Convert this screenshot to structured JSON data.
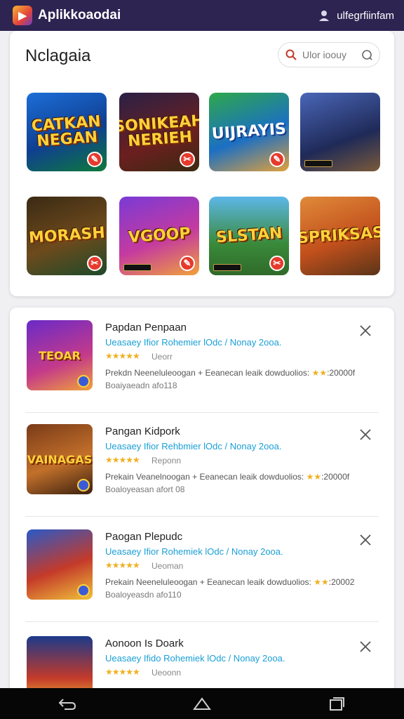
{
  "header": {
    "app_name": "Aplikkoaodai",
    "account_label": "ulfegrfiinfam"
  },
  "featured": {
    "title": "Nclagaia",
    "search_placeholder": "Ulor ioouy",
    "tiles": [
      {
        "title": "CATKAN NEGAN"
      },
      {
        "title": "SONIKEAH NERIEH"
      },
      {
        "title": "UIJRAYIS"
      },
      {
        "title": ""
      },
      {
        "title": "MORASH"
      },
      {
        "title": "VGOOP"
      },
      {
        "title": "SLSTAN"
      },
      {
        "title": "SPRIKSAS"
      }
    ]
  },
  "apps": [
    {
      "thumb_title": "TEOAR",
      "name": "Papdan Penpaan",
      "developer": "Ueasaey Ifior Rohemier lOdc / Nonay 2ooa.",
      "stars": "★★★★★",
      "rating_text": "Ueorr",
      "desc_text": "Prekdn Neeneluleoogan + Eeanecan leaik dowduolios:",
      "desc_stars": "★★",
      "desc_count": ":20000f",
      "size": "Boaiyaeadn afo118"
    },
    {
      "thumb_title": "VAINAGAS",
      "name": "Pangan Kidpork",
      "developer": "Ueasaey Ifior Rehbmier lOdc / Nonay 2ooa.",
      "stars": "★★★★★",
      "rating_text": "Reponn",
      "desc_text": "Prekain Veanelnoogan + Eeanecan leaik dowduolios:",
      "desc_stars": "★★",
      "desc_count": ":20000f",
      "size": "Boaloyeasan afort 08"
    },
    {
      "thumb_title": "",
      "name": "Paogan Plepudc",
      "developer": "Ueasaey Ifior Rohemiek lOdc / Nonay 2ooa.",
      "stars": "★★★★★",
      "rating_text": "Ueoman",
      "desc_text": "Prekain Neeneluleoogan + Eeanecan leaik dowduolios:",
      "desc_stars": "★★",
      "desc_count": ":20002",
      "size": "Boaloyeasdn afo110"
    },
    {
      "thumb_title": "",
      "name": "Aonoon Is Doark",
      "developer": "Ueasaey Ifido Rohemiek lOdc / Nonay 2ooa.",
      "stars": "★★★★★",
      "rating_text": "Ueoonn",
      "desc_text": "",
      "desc_stars": "",
      "desc_count": "",
      "size": ""
    }
  ],
  "colors": {
    "topbar": "#2d2452",
    "link": "#1a9fd6",
    "star": "#f0b020",
    "badge": "#e63a2c"
  }
}
